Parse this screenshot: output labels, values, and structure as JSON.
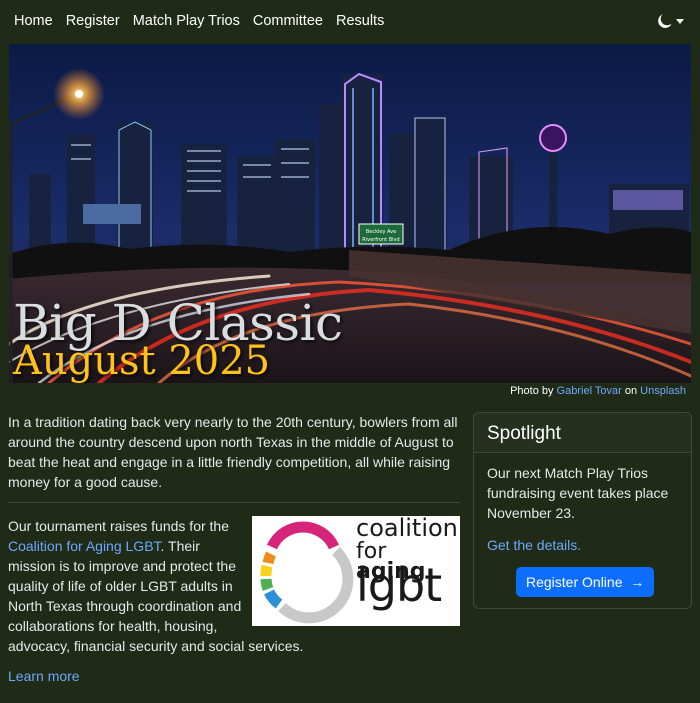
{
  "nav": {
    "items": [
      "Home",
      "Register",
      "Match Play Trios",
      "Committee",
      "Results"
    ],
    "theme_icon": "moon-icon"
  },
  "hero": {
    "title": "Big D Classic",
    "subtitle": "August 2025",
    "title_color": "#d9dde0",
    "subtitle_color": "#ffc21a",
    "sign_text_1": "Beckley Ave",
    "sign_text_2": "Riverfront Blvd"
  },
  "credit": {
    "prefix": "Photo by",
    "author": "Gabriel Tovar",
    "on": "on",
    "site": "Unsplash"
  },
  "intro": {
    "text": "In a tradition dating back very nearly to the 20th century, bowlers from all around the country descend upon north Texas in the middle of August to beat the heat and engage in a little friendly competition, all while raising money for a good cause."
  },
  "mission": {
    "before": "Our tournament raises funds for the",
    "link": "Coalition for Aging LGBT",
    "after": ". Their mission is to improve and protect the quality of life of older LGBT adults in North Texas through coordination and collaborations for health, housing, advocacy, financial security and social services.",
    "learn_more": "Learn more"
  },
  "logo": {
    "line1": "coalition",
    "line2a": "for",
    "line2b": "aging",
    "line3": "lgbt"
  },
  "spotlight": {
    "title": "Spotlight",
    "text": "Our next Match Play Trios fundraising event takes place November 23.",
    "details_link": "Get the details.",
    "button_label": "Register Online",
    "button_icon": "arrow-right-icon"
  },
  "colors": {
    "background": "#1f2a17",
    "link": "#6ea8fe",
    "button": "#0d6efd"
  }
}
